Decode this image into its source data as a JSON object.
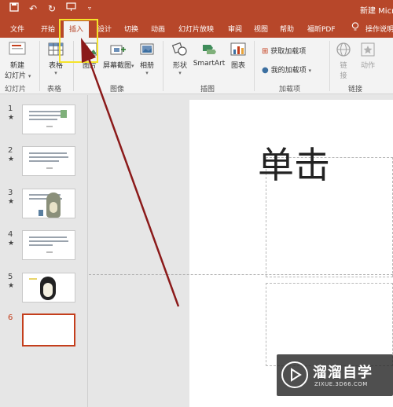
{
  "titlebar": {
    "doc_title": "新建 Micr",
    "qat": [
      "save-icon",
      "undo-icon",
      "redo-icon",
      "present-icon",
      "customize-icon"
    ]
  },
  "tabs": [
    "文件",
    "开始",
    "插入",
    "设计",
    "切换",
    "动画",
    "幻灯片放映",
    "审阅",
    "视图",
    "帮助",
    "福昕PDF"
  ],
  "active_tab": "插入",
  "tell_me": "操作说明",
  "ribbon": {
    "new_slide": [
      "新建",
      "幻灯片"
    ],
    "table": "表格",
    "picture": "图片",
    "screenshot": "屏幕截图",
    "album": "相册",
    "shapes": "形状",
    "smartart": "SmartArt",
    "chart": "图表",
    "get_addins": "获取加载项",
    "my_addins": "我的加载项",
    "link": [
      "链",
      "接"
    ],
    "action": "动作",
    "groups": [
      "幻灯片",
      "表格",
      "图像",
      "插图",
      "加载项",
      "链接"
    ]
  },
  "slides": [
    {
      "num": "1",
      "star": "★"
    },
    {
      "num": "2",
      "star": "★"
    },
    {
      "num": "3",
      "star": "★"
    },
    {
      "num": "4",
      "star": "★"
    },
    {
      "num": "5",
      "star": "★"
    },
    {
      "num": "6",
      "star": ""
    }
  ],
  "slide_title_text": "单击",
  "watermark": {
    "title": "溜溜自学",
    "url": "ZIXUE.3D66.COM"
  },
  "colors": {
    "accent": "#b7472a",
    "highlight": "#f5e32a",
    "arrow": "#8b1a1a"
  }
}
